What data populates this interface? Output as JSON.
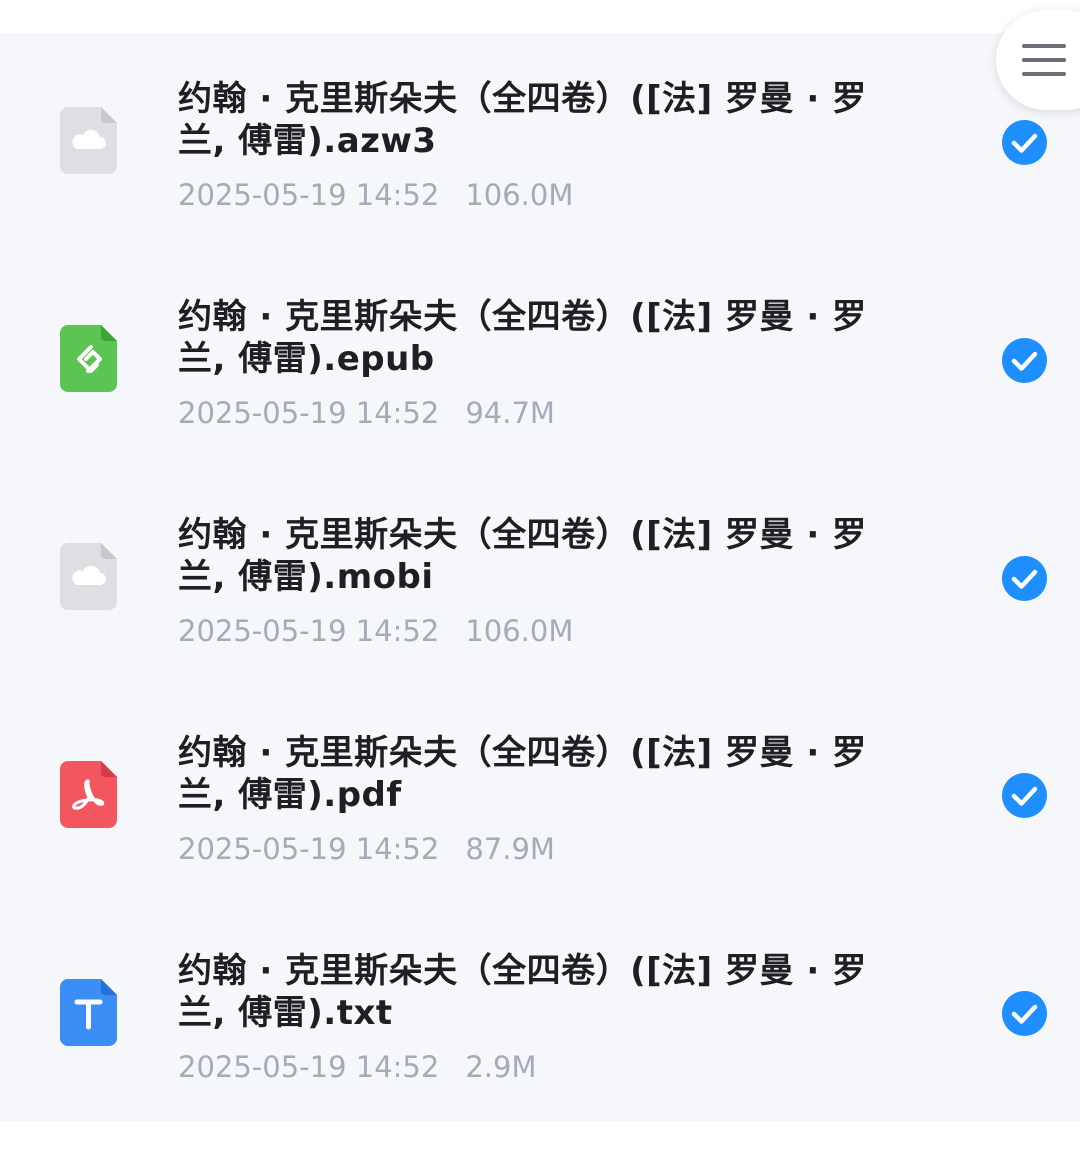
{
  "menu": {
    "icon": "hamburger-menu-icon"
  },
  "files": [
    {
      "name": "约翰 · 克里斯朵夫（全四卷）([法] 罗曼 · 罗兰, 傅雷).azw3",
      "date": "2025-05-19 14:52",
      "size": "106.0M",
      "icon": "cloud-file-icon",
      "icon_color": "#dddfe3",
      "selected": true
    },
    {
      "name": "约翰 · 克里斯朵夫（全四卷）([法] 罗曼 · 罗兰, 傅雷).epub",
      "date": "2025-05-19 14:52",
      "size": "94.7M",
      "icon": "epub-file-icon",
      "icon_color": "#5cc453",
      "selected": true
    },
    {
      "name": "约翰 · 克里斯朵夫（全四卷）([法] 罗曼 · 罗兰, 傅雷).mobi",
      "date": "2025-05-19 14:52",
      "size": "106.0M",
      "icon": "cloud-file-icon",
      "icon_color": "#dddfe3",
      "selected": true
    },
    {
      "name": "约翰 · 克里斯朵夫（全四卷）([法] 罗曼 · 罗兰, 傅雷).pdf",
      "date": "2025-05-19 14:52",
      "size": "87.9M",
      "icon": "pdf-file-icon",
      "icon_color": "#f2575f",
      "selected": true
    },
    {
      "name": "约翰 · 克里斯朵夫（全四卷）([法] 罗曼 · 罗兰, 傅雷).txt",
      "date": "2025-05-19 14:52",
      "size": "2.9M",
      "icon": "txt-file-icon",
      "icon_color": "#3a8ef6",
      "selected": true
    }
  ],
  "colors": {
    "accent": "#1f8fff",
    "meta_text": "#a6abb8",
    "title_text": "#1d1f24",
    "list_bg": "#f6f7fb"
  }
}
